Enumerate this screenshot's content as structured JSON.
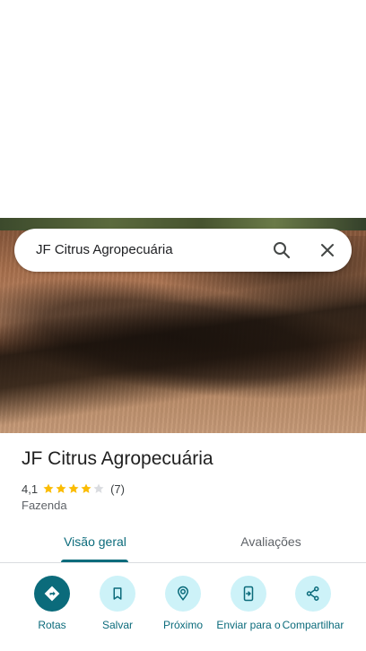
{
  "search": {
    "query": "JF Citrus Agropecuária"
  },
  "place": {
    "name": "JF Citrus Agropecuária",
    "rating": "4,1",
    "stars_filled": 4,
    "stars_total": 5,
    "review_count": "(7)",
    "category": "Fazenda"
  },
  "tabs": [
    {
      "label": "Visão geral",
      "active": true
    },
    {
      "label": "Avaliações",
      "active": false
    }
  ],
  "actions": [
    {
      "label": "Rotas",
      "icon": "directions-icon"
    },
    {
      "label": "Salvar",
      "icon": "bookmark-icon"
    },
    {
      "label": "Próximo",
      "icon": "nearby-icon"
    },
    {
      "label": "Enviar para o",
      "icon": "send-to-phone-icon"
    },
    {
      "label": "Compartilhar",
      "icon": "share-icon"
    }
  ],
  "colors": {
    "accent": "#0b6b7b",
    "action_bg": "#cdf2f8",
    "star": "#fbbc04"
  }
}
